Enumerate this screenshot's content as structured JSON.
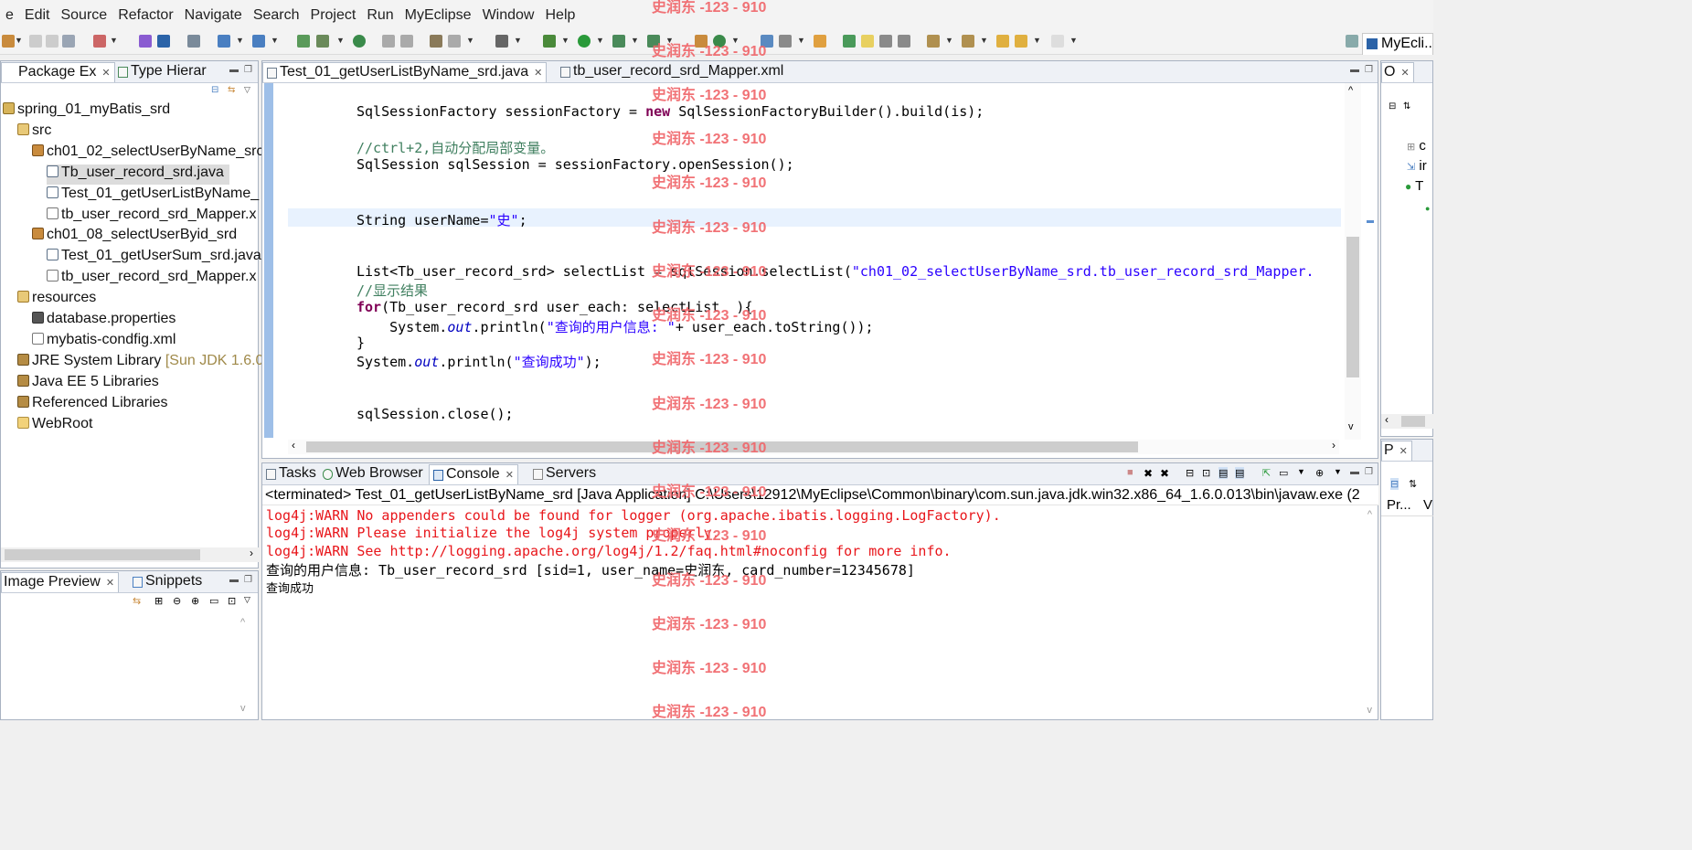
{
  "menu": [
    "e",
    "Edit",
    "Source",
    "Refactor",
    "Navigate",
    "Search",
    "Project",
    "Run",
    "MyEclipse",
    "Window",
    "Help"
  ],
  "perspective": {
    "label": "MyEcli..."
  },
  "package_explorer": {
    "tabs": [
      "Package Ex",
      "Type Hierar"
    ],
    "tree": [
      {
        "label": "spring_01_myBatis_srd",
        "icon": "project-icon"
      },
      {
        "label": "src",
        "icon": "source-folder-icon"
      },
      {
        "label": "ch01_02_selectUserByName_src",
        "icon": "package-icon"
      },
      {
        "label": "Tb_user_record_srd.java",
        "icon": "java-file-icon"
      },
      {
        "label": "Test_01_getUserListByName_",
        "icon": "java-file-icon"
      },
      {
        "label": "tb_user_record_srd_Mapper.x",
        "icon": "xml-file-icon"
      },
      {
        "label": "ch01_08_selectUserByid_srd",
        "icon": "package-icon"
      },
      {
        "label": "Test_01_getUserSum_srd.java",
        "icon": "java-file-icon"
      },
      {
        "label": "tb_user_record_srd_Mapper.x",
        "icon": "xml-file-icon"
      },
      {
        "label": "resources",
        "icon": "source-folder-icon"
      },
      {
        "label": "database.properties",
        "icon": "properties-file-icon"
      },
      {
        "label": "mybatis-condfig.xml",
        "icon": "xml-file-icon"
      },
      {
        "label": "JRE System Library",
        "suffix": "[Sun JDK 1.6.0",
        "icon": "library-icon"
      },
      {
        "label": "Java EE 5 Libraries",
        "icon": "library-icon"
      },
      {
        "label": "Referenced Libraries",
        "icon": "library-icon"
      },
      {
        "label": "WebRoot",
        "icon": "folder-icon"
      }
    ]
  },
  "image_preview": {
    "tabs": [
      "Image Preview",
      "Snippets"
    ]
  },
  "editor": {
    "tabs": [
      "Test_01_getUserListByName_srd.java",
      "tb_user_record_srd_Mapper.xml"
    ],
    "lines": {
      "l1a": "SqlSessionFactory sessionFactory = ",
      "l1kw": "new",
      "l1b": " SqlSessionFactoryBuilder().build(is);",
      "l2": "//ctrl+2,自动分配局部变量。",
      "l3": "SqlSession sqlSession = sessionFactory.openSession();",
      "l4a": "String userName=",
      "l4s": "\"史\"",
      "l4b": ";",
      "l5a": "List<Tb_user_record_srd> selectList = sqlSession.selectList(",
      "l5s": "\"ch01_02_selectUserByName_srd.tb_user_record_srd_Mapper.",
      "l6": "//显示结果",
      "l7kw": "for",
      "l7b": "(Tb_user_record_srd user_each: selectList  ){",
      "l8a": "    System.",
      "l8it": "out",
      "l8b": ".println(",
      "l8s": "\"查询的用户信息: \"",
      "l8c": "+ user_each.toString());",
      "l9": "}",
      "l10a": "System.",
      "l10it": "out",
      "l10b": ".println(",
      "l10s": "\"查询成功\"",
      "l10c": ");",
      "l11": "sqlSession.close();"
    }
  },
  "outline": {
    "tab": "O",
    "items": [
      "c",
      "ir",
      "T"
    ]
  },
  "properties": {
    "tab": "P",
    "col1": "Pr...",
    "col2": "V"
  },
  "console": {
    "tabs": [
      "Tasks",
      "Web Browser",
      "Console",
      "Servers"
    ],
    "header": "<terminated> Test_01_getUserListByName_srd [Java Application] C:\\Users\\12912\\MyEclipse\\Common\\binary\\com.sun.java.jdk.win32.x86_64_1.6.0.013\\bin\\javaw.exe (2",
    "lines": [
      {
        "text": "log4j:WARN No appenders could be found for logger (org.apache.ibatis.logging.LogFactory).",
        "type": "err"
      },
      {
        "text": "log4j:WARN Please initialize the log4j system properly.",
        "type": "err"
      },
      {
        "text": "log4j:WARN See http://logging.apache.org/log4j/1.2/faq.html#noconfig for more info.",
        "type": "err"
      },
      {
        "text": "查询的用户信息: Tb_user_record_srd [sid=1, user_name=史润东, card_number=12345678]",
        "type": "out"
      },
      {
        "text": "查询成功",
        "type": "out"
      }
    ]
  },
  "watermark": "史润东 -123 - 910"
}
